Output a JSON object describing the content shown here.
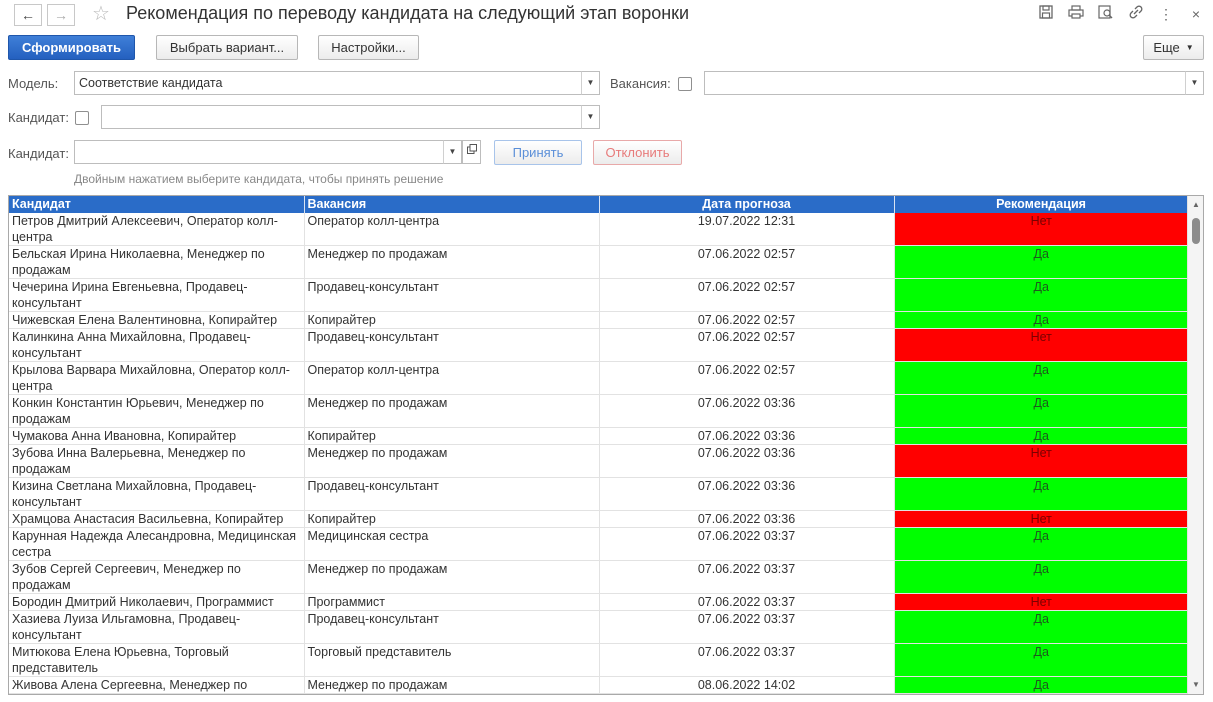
{
  "window": {
    "title": "Рекомендация по переводу кандидата на следующий этап воронки",
    "icons": [
      "back-arrow-icon",
      "forward-arrow-icon",
      "star-icon",
      "save-icon",
      "print-icon",
      "preview-icon",
      "link-icon",
      "more-vertical-icon",
      "close-icon"
    ]
  },
  "toolbar": {
    "generate_label": "Сформировать",
    "choose_variant_label": "Выбрать вариант...",
    "settings_label": "Настройки...",
    "more_label": "Еще"
  },
  "filters": {
    "model_label": "Модель:",
    "model_value": "Соответствие кандидата",
    "vacancy_label": "Вакансия:",
    "vacancy_value": "",
    "candidate_label": "Кандидат:",
    "candidate_value": "",
    "candidate2_label": "Кандидат:",
    "candidate2_value": "",
    "accept_label": "Принять",
    "reject_label": "Отклонить",
    "hint": "Двойным нажатием выберите кандидата, чтобы принять решение"
  },
  "table": {
    "columns": [
      "Кандидат",
      "Вакансия",
      "Дата прогноза",
      "Рекомендация"
    ],
    "rows": [
      {
        "candidate": "Петров Дмитрий Алексеевич, Оператор колл-центра",
        "vacancy": "Оператор колл-центра",
        "date": "19.07.2022 12:31",
        "rec": "Нет"
      },
      {
        "candidate": "Бельская Ирина Николаевна, Менеджер по продажам",
        "vacancy": "Менеджер по продажам",
        "date": "07.06.2022 02:57",
        "rec": "Да"
      },
      {
        "candidate": "Чечерина Ирина Евгеньевна, Продавец-консультант",
        "vacancy": "Продавец-консультант",
        "date": "07.06.2022 02:57",
        "rec": "Да"
      },
      {
        "candidate": "Чижевская Елена Валентиновна, Копирайтер",
        "vacancy": "Копирайтер",
        "date": "07.06.2022 02:57",
        "rec": "Да"
      },
      {
        "candidate": "Калинкина Анна Михайловна, Продавец-консультант",
        "vacancy": "Продавец-консультант",
        "date": "07.06.2022 02:57",
        "rec": "Нет"
      },
      {
        "candidate": "Крылова Варвара Михайловна, Оператор колл-центра",
        "vacancy": "Оператор колл-центра",
        "date": "07.06.2022 02:57",
        "rec": "Да"
      },
      {
        "candidate": "Конкин Константин Юрьевич, Менеджер по продажам",
        "vacancy": "Менеджер по продажам",
        "date": "07.06.2022 03:36",
        "rec": "Да"
      },
      {
        "candidate": "Чумакова Анна Ивановна, Копирайтер",
        "vacancy": "Копирайтер",
        "date": "07.06.2022 03:36",
        "rec": "Да"
      },
      {
        "candidate": "Зубова Инна Валерьевна, Менеджер по продажам",
        "vacancy": "Менеджер по продажам",
        "date": "07.06.2022 03:36",
        "rec": "Нет"
      },
      {
        "candidate": "Кизина Светлана Михайловна, Продавец-консультант",
        "vacancy": "Продавец-консультант",
        "date": "07.06.2022 03:36",
        "rec": "Да"
      },
      {
        "candidate": "Храмцова Анастасия Васильевна, Копирайтер",
        "vacancy": "Копирайтер",
        "date": "07.06.2022 03:36",
        "rec": "Нет"
      },
      {
        "candidate": "Карунная Надежда Алесандровна, Медицинская сестра",
        "vacancy": "Медицинская сестра",
        "date": "07.06.2022 03:37",
        "rec": "Да"
      },
      {
        "candidate": "Зубов Сергей Сергеевич, Менеджер по продажам",
        "vacancy": "Менеджер по продажам",
        "date": "07.06.2022 03:37",
        "rec": "Да"
      },
      {
        "candidate": "Бородин Дмитрий Николаевич, Программист",
        "vacancy": "Программист",
        "date": "07.06.2022 03:37",
        "rec": "Нет"
      },
      {
        "candidate": "Хазиева Луиза Ильгамовна, Продавец-консультант",
        "vacancy": "Продавец-консультант",
        "date": "07.06.2022 03:37",
        "rec": "Да"
      },
      {
        "candidate": "Митюкова Елена Юрьевна, Торговый представитель",
        "vacancy": "Торговый представитель",
        "date": "07.06.2022 03:37",
        "rec": "Да"
      },
      {
        "candidate": "Живова Алена Сергеевна, Менеджер по",
        "vacancy": "Менеджер по продажам",
        "date": "08.06.2022 14:02",
        "rec": "Да"
      }
    ]
  },
  "colors": {
    "yes": "#00ff00",
    "no": "#ff0000",
    "header": "#2a6cc8",
    "primary": "#2460bf"
  }
}
